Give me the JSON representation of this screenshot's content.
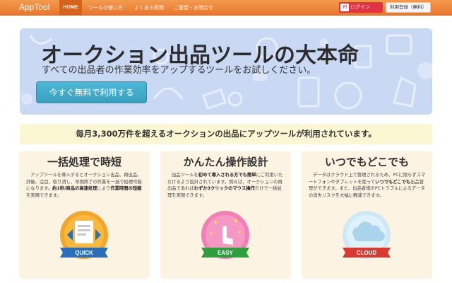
{
  "navbar": {
    "brand": "AppTool",
    "items": [
      {
        "label": "HOME",
        "active": true
      },
      {
        "label": "ツールの使い方"
      },
      {
        "label": "よくある質問"
      },
      {
        "label": "ご要望・お問合せ"
      }
    ],
    "login_badge": "Y!",
    "login_label": "ログイン",
    "register_label": "利用登録（無料）"
  },
  "hero": {
    "title": "オークション出品ツールの大本命",
    "subtitle": "すべての出品者の作業効率をアップするツールをお試しください。",
    "cta_label": "今すぐ無料で利用する"
  },
  "banner": {
    "text": "毎月3,300万件を超えるオークションの出品にアップツールが利用されています。"
  },
  "features": [
    {
      "title": "一括処理で時短",
      "text_parts": [
        {
          "t": "アップツールを導入するとオークション出品、再出品、評価、注目、取り消し、早期終了の作業を一括で処理可能になります。"
        },
        {
          "t": "約1秒/商品の高速処理",
          "b": true
        },
        {
          "t": "により"
        },
        {
          "t": "作業時間の短縮",
          "b": true
        },
        {
          "t": "を実現できます。"
        }
      ],
      "badge": "QUICK"
    },
    {
      "title": "かんたん操作設計",
      "text_parts": [
        {
          "t": "出品ツールを"
        },
        {
          "t": "初めて導入される方でも簡単",
          "b": true
        },
        {
          "t": "にご利用いただけるよう設計されています。例えば、オークションの再出品であれば"
        },
        {
          "t": "わずか3クリックのマウス操作",
          "b": true
        },
        {
          "t": "だけで一括処理を実現できます。"
        }
      ],
      "badge": "EASY"
    },
    {
      "title": "いつでもどこでも",
      "text_parts": [
        {
          "t": "データはクラウド上で管理されるため、PCに限らずスマートフォンやタブレットを使って"
        },
        {
          "t": "いつでもどこでも",
          "b": true
        },
        {
          "t": "出品管理ができます。また、出品者様のPCトラブルによるデータの消失リスクを大幅に軽減できます。"
        }
      ],
      "badge": "CLOUD"
    }
  ],
  "colors": {
    "nav": "#ef8a3e",
    "hero_bg": "#c9d9f4",
    "cta": "#44acd0",
    "banner_bg": "#fcf7d3",
    "card_bg": "#fdf3e3",
    "login": "#e23344",
    "ribbon_blue": "#2a6fb9",
    "ribbon_green": "#2e9e3e",
    "ribbon_red": "#d83a2f"
  }
}
